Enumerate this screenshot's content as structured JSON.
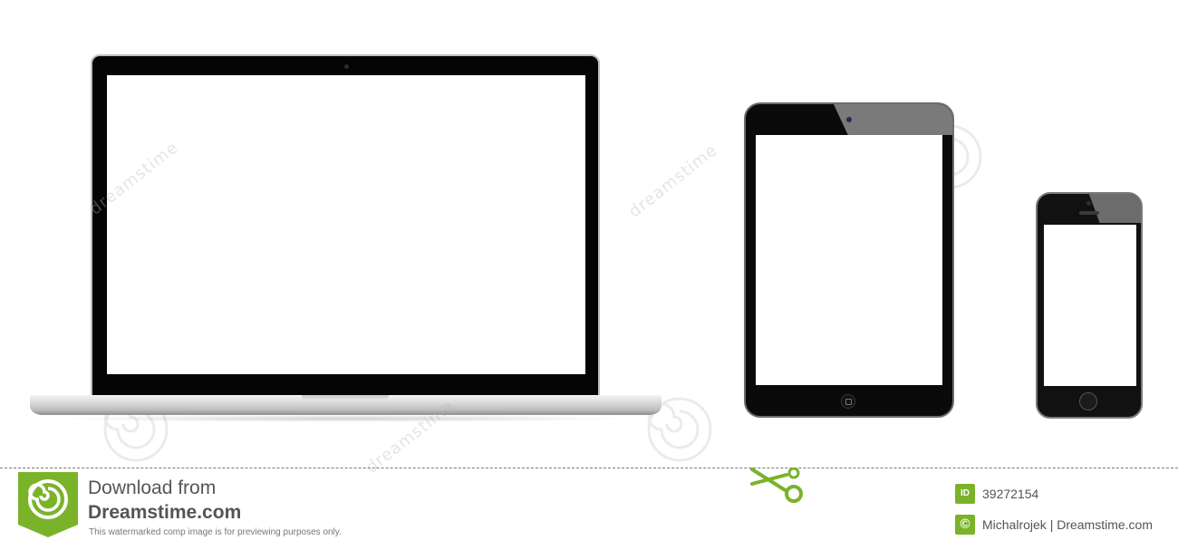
{
  "scene": {
    "devices": [
      "laptop",
      "tablet",
      "phone"
    ],
    "watermark_text": "dreamstime"
  },
  "footer": {
    "title": "Download from",
    "brand": "Dreamstime.com",
    "note": "This watermarked comp image is for previewing purposes only.",
    "id_label": "ID",
    "id_value": "39272154",
    "author": "Michalrojek | Dreamstime.com",
    "copyright_symbol": "©"
  },
  "colors": {
    "brand_green": "#7ab32a",
    "device_black": "#0a0a0a",
    "laptop_silver": "#d9d9d9"
  },
  "icons": {
    "logo": "dreamstime-swirl-logo-icon",
    "scissors": "scissors-icon",
    "id_badge": "id-badge-icon",
    "copyright": "copyright-icon"
  }
}
